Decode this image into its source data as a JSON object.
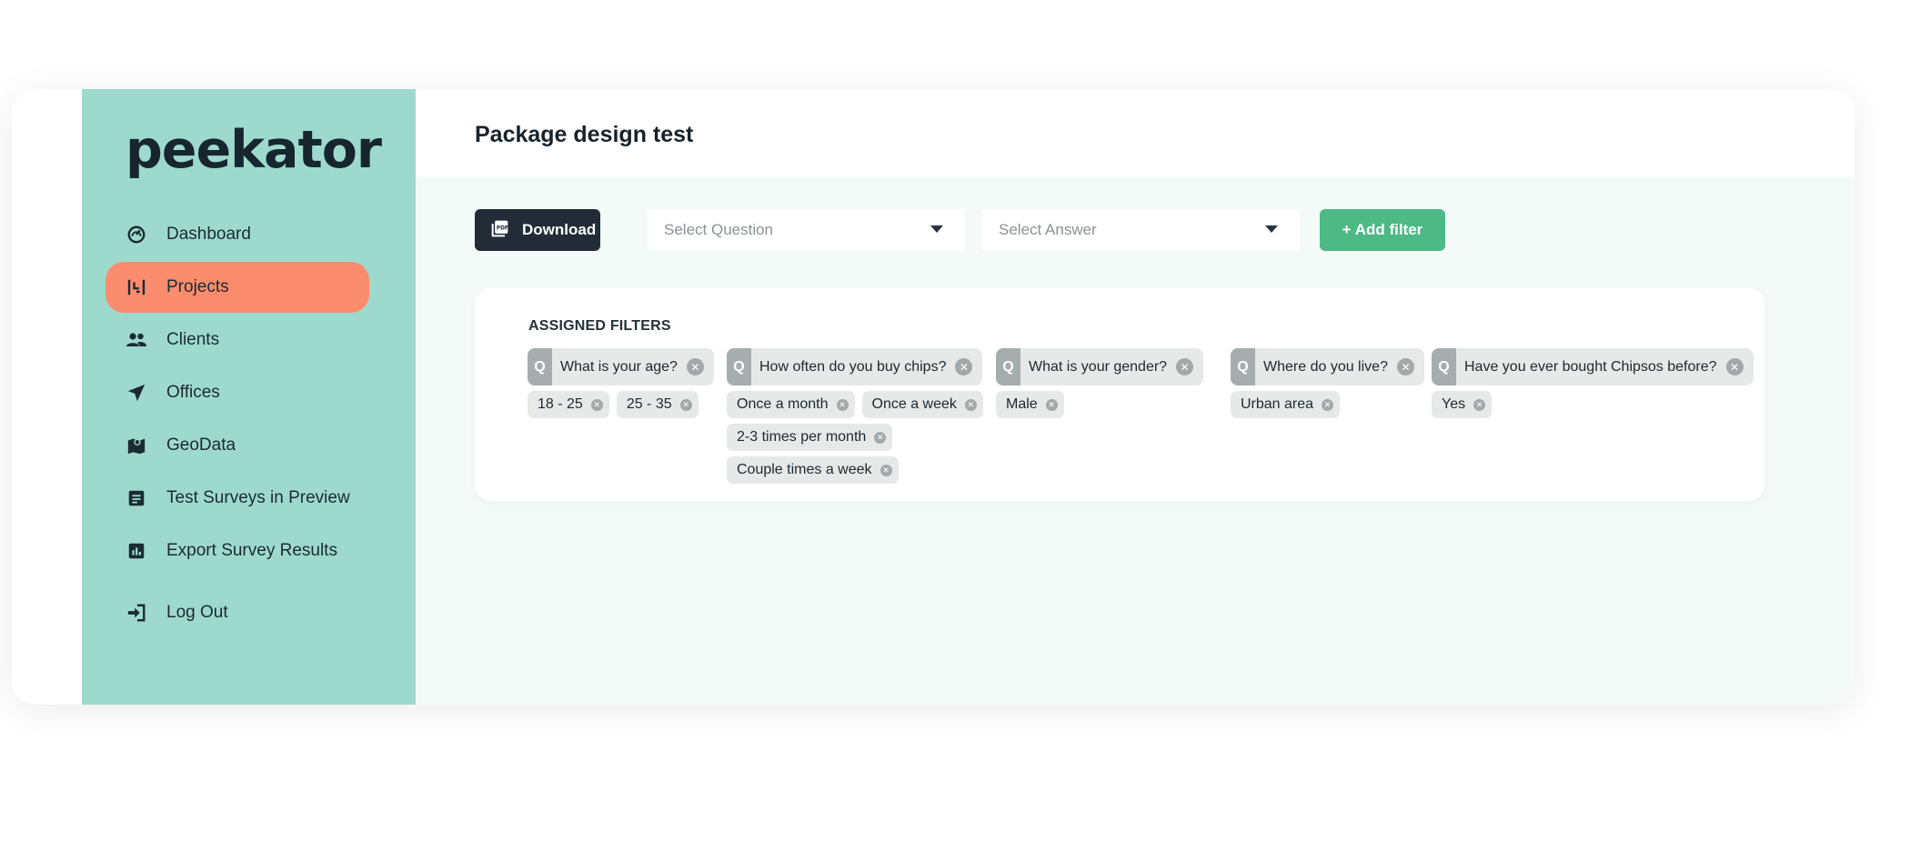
{
  "brand": {
    "logo_text": "peekator"
  },
  "sidebar": {
    "items": [
      {
        "label": "Dashboard",
        "icon": "dashboard-icon",
        "active": false
      },
      {
        "label": "Projects",
        "icon": "projects-icon",
        "active": true
      },
      {
        "label": "Clients",
        "icon": "clients-icon",
        "active": false
      },
      {
        "label": "Offices",
        "icon": "navigation-arrow-icon",
        "active": false
      },
      {
        "label": "GeoData",
        "icon": "map-pin-icon",
        "active": false
      },
      {
        "label": "Test Surveys in Preview",
        "icon": "document-icon",
        "active": false
      },
      {
        "label": "Export  Survey Results",
        "icon": "bar-chart-icon",
        "active": false
      }
    ],
    "logout": {
      "label": "Log Out",
      "icon": "logout-icon"
    }
  },
  "header": {
    "title": "Package design test"
  },
  "toolbar": {
    "download_label": "Download",
    "question_select": {
      "placeholder": "Select Question"
    },
    "answer_select": {
      "placeholder": "Select Answer"
    },
    "add_filter_label": "+ Add filter"
  },
  "filters": {
    "title": "ASSIGNED FILTERS",
    "badge": "Q",
    "groups": [
      {
        "question": "What is your age?",
        "answers": [
          "18 - 25",
          "25 - 35"
        ]
      },
      {
        "question": "How often do you buy chips?",
        "answers": [
          "Once a month",
          "Once a week",
          "2-3 times per month",
          "Couple times a week"
        ]
      },
      {
        "question": "What is your gender?",
        "answers": [
          "Male"
        ]
      },
      {
        "question": "Where do you live?",
        "answers": [
          "Urban area"
        ]
      },
      {
        "question": "Have you ever bought Chipsos before?",
        "answers": [
          "Yes"
        ]
      }
    ]
  },
  "colors": {
    "sidebar_bg": "#9ddacd",
    "active_item": "#fb8c6d",
    "primary_dark": "#212c36",
    "accent_green": "#4db985",
    "main_bg": "#f4faf8"
  }
}
